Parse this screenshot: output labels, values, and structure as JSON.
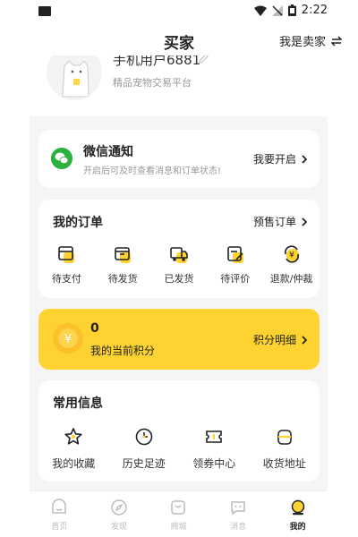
{
  "status_bar": {
    "time": "2:22"
  },
  "header": {
    "title": "买家",
    "switch_label": "我是卖家"
  },
  "profile": {
    "username": "手机用户6881",
    "subtitle": "精品宠物交易平台"
  },
  "wechat": {
    "title": "微信通知",
    "description": "开启后可及时查看消息和订单状态!",
    "action_label": "我要开启"
  },
  "orders": {
    "title": "我的订单",
    "action_label": "预售订单",
    "items": [
      {
        "label": "待支付",
        "icon": "pending-payment-icon"
      },
      {
        "label": "待发货",
        "icon": "pending-shipment-icon"
      },
      {
        "label": "已发货",
        "icon": "shipped-icon"
      },
      {
        "label": "待评价",
        "icon": "pending-review-icon"
      },
      {
        "label": "退款/仲裁",
        "icon": "refund-icon"
      }
    ]
  },
  "points": {
    "value": "0",
    "label": "我的当前积分",
    "action_label": "积分明细"
  },
  "common": {
    "title": "常用信息",
    "items": [
      {
        "label": "我的收藏",
        "icon": "star-icon"
      },
      {
        "label": "历史足迹",
        "icon": "clock-icon"
      },
      {
        "label": "领券中心",
        "icon": "coupon-icon"
      },
      {
        "label": "收货地址",
        "icon": "address-icon"
      }
    ]
  },
  "tabs": [
    {
      "label": "首页",
      "icon": "home-icon",
      "active": false
    },
    {
      "label": "发现",
      "icon": "discover-icon",
      "active": false
    },
    {
      "label": "商城",
      "icon": "shop-icon",
      "active": false
    },
    {
      "label": "消息",
      "icon": "message-icon",
      "active": false
    },
    {
      "label": "我的",
      "icon": "profile-icon",
      "active": true
    }
  ],
  "colors": {
    "accent": "#fed331",
    "wechat_green": "#2bb13f",
    "background": "#f5f5f5"
  }
}
